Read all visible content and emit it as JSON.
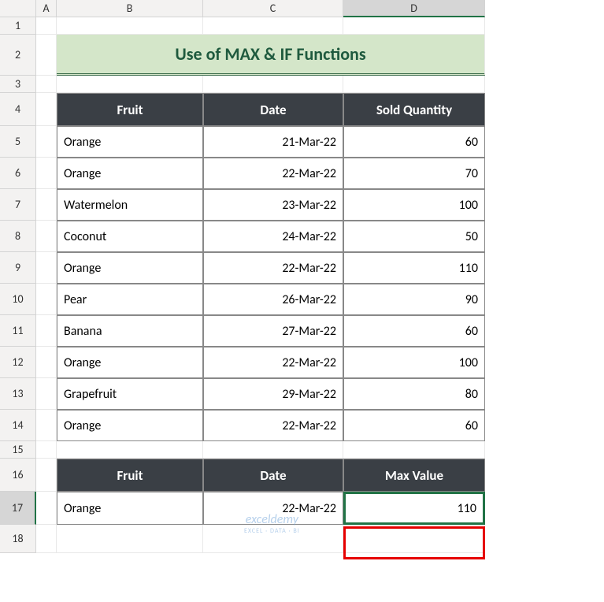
{
  "columns": [
    "A",
    "B",
    "C",
    "D"
  ],
  "rows": [
    "1",
    "2",
    "3",
    "4",
    "5",
    "6",
    "7",
    "8",
    "9",
    "10",
    "11",
    "12",
    "13",
    "14",
    "15",
    "16",
    "17",
    "18"
  ],
  "title": "Use of MAX & IF Functions",
  "table1": {
    "headers": [
      "Fruit",
      "Date",
      "Sold Quantity"
    ],
    "rows": [
      {
        "fruit": "Orange",
        "date": "21-Mar-22",
        "qty": "60"
      },
      {
        "fruit": "Orange",
        "date": "22-Mar-22",
        "qty": "70"
      },
      {
        "fruit": "Watermelon",
        "date": "23-Mar-22",
        "qty": "100"
      },
      {
        "fruit": "Coconut",
        "date": "24-Mar-22",
        "qty": "50"
      },
      {
        "fruit": "Orange",
        "date": "22-Mar-22",
        "qty": "110"
      },
      {
        "fruit": "Pear",
        "date": "26-Mar-22",
        "qty": "90"
      },
      {
        "fruit": "Banana",
        "date": "27-Mar-22",
        "qty": "60"
      },
      {
        "fruit": "Orange",
        "date": "22-Mar-22",
        "qty": "100"
      },
      {
        "fruit": "Grapefruit",
        "date": "29-Mar-22",
        "qty": "80"
      },
      {
        "fruit": "Orange",
        "date": "22-Mar-22",
        "qty": "60"
      }
    ]
  },
  "table2": {
    "headers": [
      "Fruit",
      "Date",
      "Max Value"
    ],
    "row": {
      "fruit": "Orange",
      "date": "22-Mar-22",
      "max": "110"
    }
  },
  "selected_col": "D",
  "selected_row": "17",
  "watermark": {
    "line1": "exceldemy",
    "line2": "EXCEL · DATA · BI"
  },
  "chart_data": {
    "type": "table",
    "title": "Use of MAX & IF Functions",
    "columns": [
      "Fruit",
      "Date",
      "Sold Quantity"
    ],
    "rows": [
      [
        "Orange",
        "21-Mar-22",
        60
      ],
      [
        "Orange",
        "22-Mar-22",
        70
      ],
      [
        "Watermelon",
        "23-Mar-22",
        100
      ],
      [
        "Coconut",
        "24-Mar-22",
        50
      ],
      [
        "Orange",
        "22-Mar-22",
        110
      ],
      [
        "Pear",
        "26-Mar-22",
        90
      ],
      [
        "Banana",
        "27-Mar-22",
        60
      ],
      [
        "Orange",
        "22-Mar-22",
        100
      ],
      [
        "Grapefruit",
        "29-Mar-22",
        80
      ],
      [
        "Orange",
        "22-Mar-22",
        60
      ]
    ],
    "result": {
      "Fruit": "Orange",
      "Date": "22-Mar-22",
      "Max Value": 110
    }
  }
}
